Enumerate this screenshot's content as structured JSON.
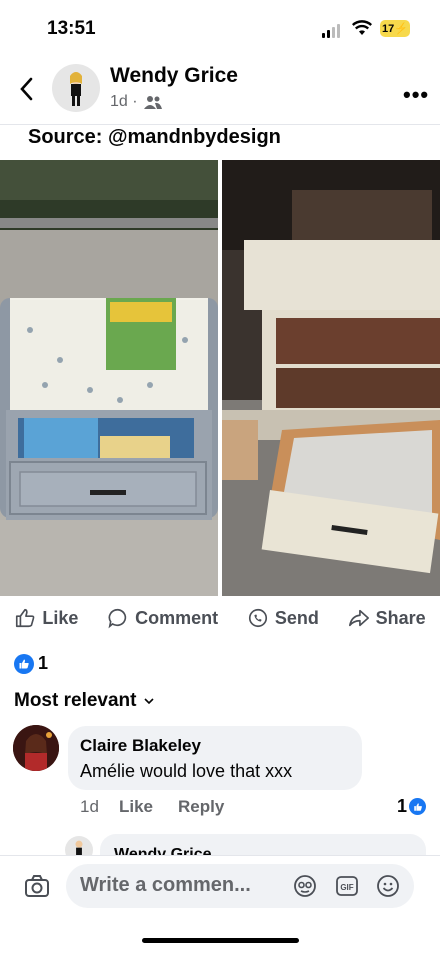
{
  "status_bar": {
    "time": "13:51",
    "battery": "17"
  },
  "header": {
    "author": "Wendy Grice",
    "time": "1d ·"
  },
  "post": {
    "caption": "Source: @mandnbydesign"
  },
  "actions": {
    "like": "Like",
    "comment": "Comment",
    "send": "Send",
    "share": "Share"
  },
  "reactions": {
    "count": "1"
  },
  "comments": {
    "sort_label": "Most relevant",
    "items": [
      {
        "name": "Claire Blakeley",
        "text": "Amélie would love that xxx",
        "time": "1d",
        "like": "Like",
        "reply": "Reply",
        "reaction_count": "1"
      }
    ],
    "reply_preview": {
      "name": "Wendy Grice"
    }
  },
  "composer": {
    "placeholder": "Write a commen..."
  },
  "colors": {
    "brand_blue": "#1877f2",
    "battery": "#f7d94c"
  },
  "icons": [
    "back-arrow-icon",
    "friends-icon",
    "more-icon",
    "like-icon",
    "comment-icon",
    "send-icon",
    "share-icon",
    "camera-icon",
    "avatar-sticker-icon",
    "gif-icon",
    "emoji-icon"
  ]
}
